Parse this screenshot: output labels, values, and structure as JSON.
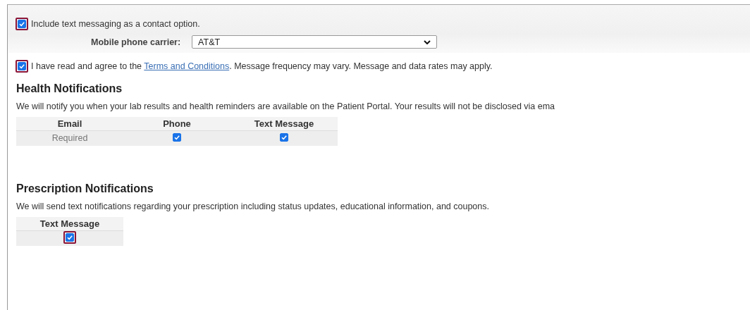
{
  "sms_option": {
    "label": "Include text messaging as a contact option.",
    "checked": true,
    "focused": true
  },
  "carrier": {
    "label": "Mobile phone carrier:",
    "value": "AT&T"
  },
  "terms": {
    "checked": true,
    "focused": true,
    "before": "I have read and agree to the ",
    "link": "Terms and Conditions",
    "after": ". Message frequency may vary. Message and data rates may apply."
  },
  "sections": [
    {
      "title": "Health Notifications",
      "description": "We will notify you when your lab results and health reminders are available on the Patient Portal. Your results will not be disclosed via ema",
      "columns": [
        "Email",
        "Phone",
        "Text Message"
      ],
      "cells": [
        {
          "kind": "text",
          "text": "Required"
        },
        {
          "kind": "checkbox",
          "checked": true,
          "focused": false
        },
        {
          "kind": "checkbox",
          "checked": true,
          "focused": false
        }
      ]
    },
    {
      "title": "Prescription Notifications",
      "description": "We will send text notifications regarding your prescription including status updates, educational information, and coupons.",
      "columns": [
        "Text Message"
      ],
      "cells": [
        {
          "kind": "checkbox",
          "checked": true,
          "focused": true
        }
      ]
    }
  ]
}
